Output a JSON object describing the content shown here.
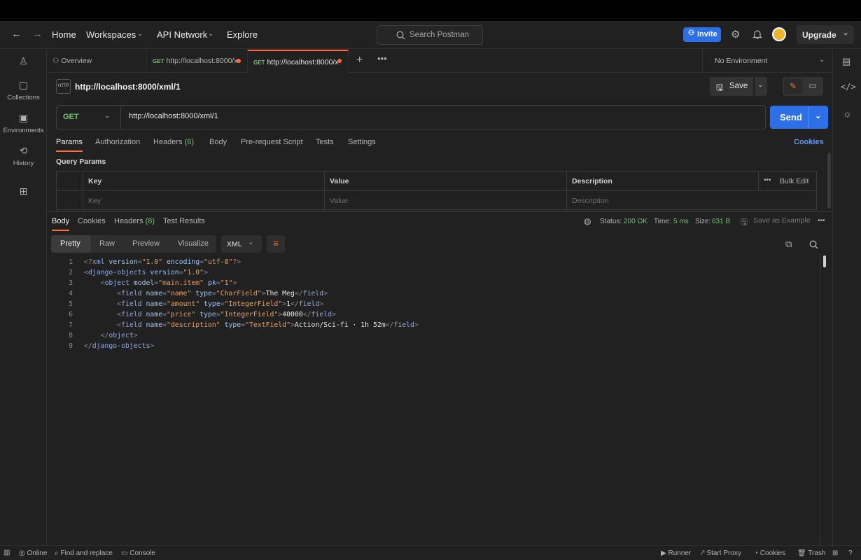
{
  "header": {
    "nav": [
      "Home",
      "Workspaces",
      "API Network",
      "Explore"
    ],
    "search_placeholder": "Search Postman",
    "invite": "Invite",
    "upgrade": "Upgrade"
  },
  "sidebar": {
    "items": [
      {
        "label": "Collections",
        "icon": "collections-icon"
      },
      {
        "label": "Environments",
        "icon": "environments-icon"
      },
      {
        "label": "History",
        "icon": "history-icon"
      }
    ]
  },
  "tabs": {
    "overview": "Overview",
    "items": [
      {
        "method": "GET",
        "url": "http://localhost:8000/x"
      },
      {
        "method": "GET",
        "url": "http://localhost:8000/x"
      }
    ],
    "environment": "No Environment"
  },
  "request": {
    "title": "http://localhost:8000/xml/1",
    "save": "Save",
    "method": "GET",
    "url": "http://localhost:8000/xml/1",
    "send": "Send",
    "tabs": {
      "params": "Params",
      "authorization": "Authorization",
      "headers": "Headers",
      "headers_count": "(6)",
      "body": "Body",
      "prerequest": "Pre-request Script",
      "tests": "Tests",
      "settings": "Settings",
      "cookies": "Cookies"
    },
    "query_params_label": "Query Params",
    "table": {
      "headers": [
        "Key",
        "Value",
        "Description"
      ],
      "placeholders": [
        "Key",
        "Value",
        "Description"
      ],
      "bulk_edit": "Bulk Edit"
    }
  },
  "response": {
    "tabs": {
      "body": "Body",
      "cookies": "Cookies",
      "headers": "Headers",
      "headers_count": "(8)",
      "test_results": "Test Results"
    },
    "status_label": "Status:",
    "status_value": "200 OK",
    "time_label": "Time:",
    "time_value": "5 ms",
    "size_label": "Size:",
    "size_value": "631 B",
    "save_example": "Save as Example",
    "views": [
      "Pretty",
      "Raw",
      "Preview",
      "Visualize"
    ],
    "format": "XML",
    "line_numbers": [
      "1",
      "2",
      "3",
      "4",
      "5",
      "6",
      "7",
      "8",
      "9"
    ]
  },
  "statusbar": {
    "online": "Online",
    "find": "Find and replace",
    "console": "Console",
    "runner": "Runner",
    "proxy": "Start Proxy",
    "cookies": "Cookies",
    "trash": "Trash"
  }
}
